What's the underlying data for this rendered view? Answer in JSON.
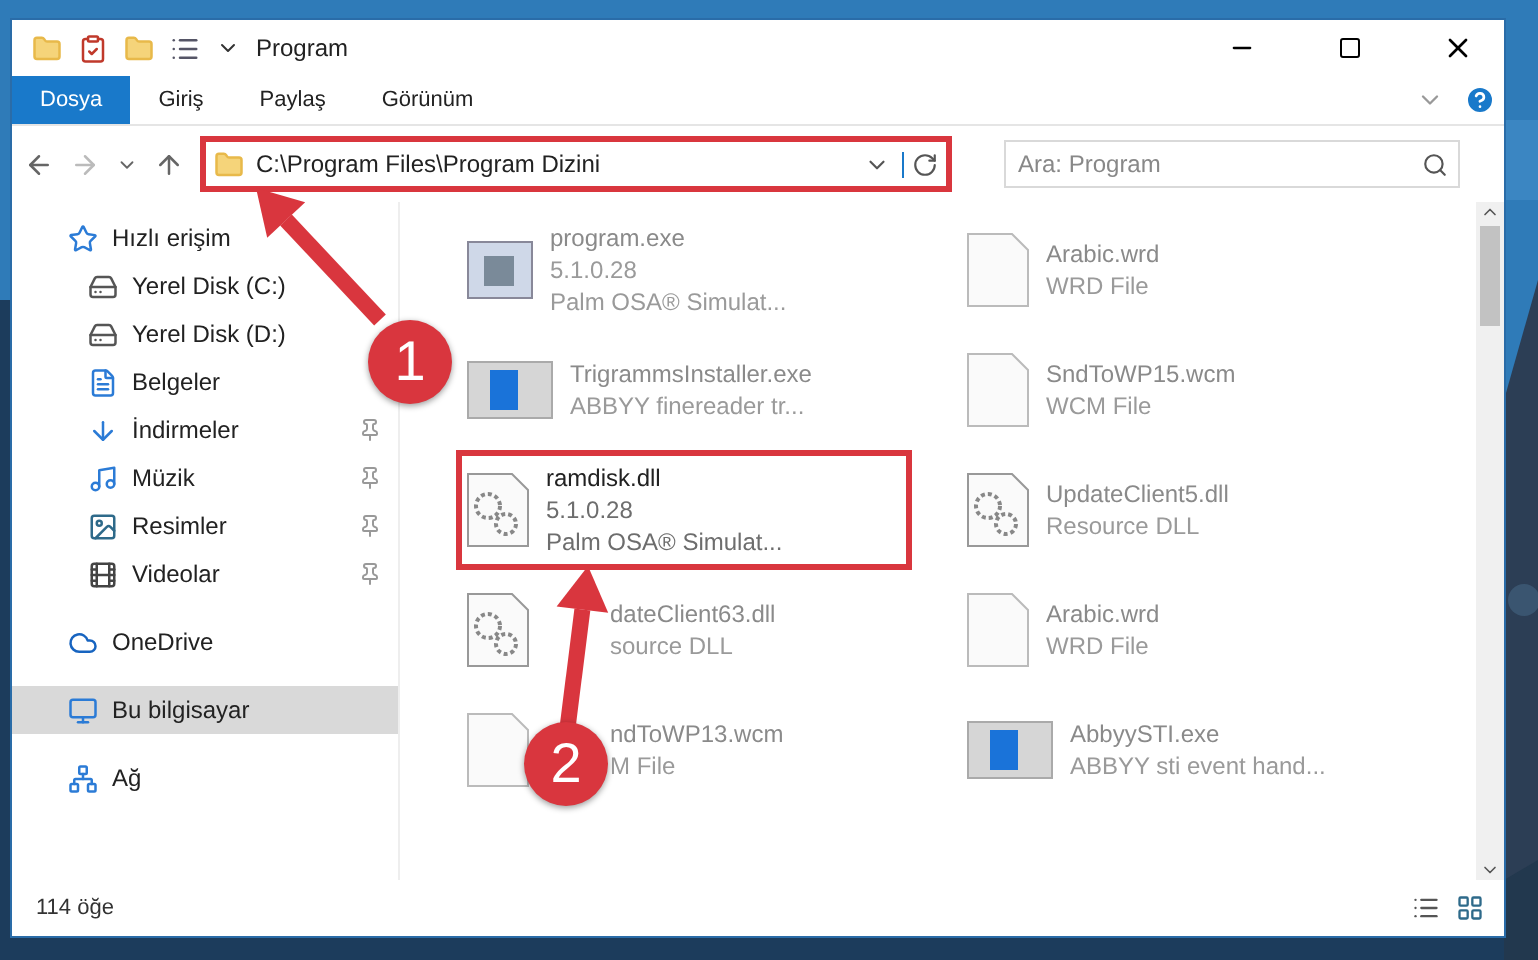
{
  "window": {
    "title": "Program"
  },
  "ribbon_tabs": [
    {
      "label": "Dosya",
      "selected": true
    },
    {
      "label": "Giriş",
      "selected": false
    },
    {
      "label": "Paylaş",
      "selected": false
    },
    {
      "label": "Görünüm",
      "selected": false
    }
  ],
  "address": {
    "path": "C:\\Program Files\\Program Dizini",
    "highlighted": true
  },
  "search": {
    "placeholder": "Ara: Program"
  },
  "sidebar": {
    "items": [
      {
        "label": "Hızlı erişim",
        "kind": "star",
        "selected": false,
        "children": [
          {
            "label": "Yerel Disk (C:)",
            "kind": "disk",
            "pinned": false
          },
          {
            "label": "Yerel Disk (D:)",
            "kind": "disk",
            "pinned": false
          },
          {
            "label": "Belgeler",
            "kind": "docs",
            "pinned": false
          },
          {
            "label": "İndirmeler",
            "kind": "download",
            "pinned": true
          },
          {
            "label": "Müzik",
            "kind": "music",
            "pinned": true
          },
          {
            "label": "Resimler",
            "kind": "pictures",
            "pinned": true
          },
          {
            "label": "Videolar",
            "kind": "video",
            "pinned": true
          }
        ]
      },
      {
        "label": "OneDrive",
        "kind": "cloud",
        "selected": false
      },
      {
        "label": "Bu bilgisayar",
        "kind": "pc",
        "selected": true
      },
      {
        "label": "Ağ",
        "kind": "network",
        "selected": false
      }
    ]
  },
  "files": [
    {
      "name": "program.exe",
      "lines": [
        "5.1.0.28",
        "Palm OSA® Simulat..."
      ],
      "kind": "exe",
      "blurred": true,
      "highlighted": false
    },
    {
      "name": "Arabic.wrd",
      "lines": [
        "WRD File"
      ],
      "kind": "blank",
      "blurred": true,
      "highlighted": false
    },
    {
      "name": "TrigrammsInstaller.exe",
      "lines": [
        "ABBYY finereader tr..."
      ],
      "kind": "installer",
      "blurred": true,
      "highlighted": false
    },
    {
      "name": "SndToWP15.wcm",
      "lines": [
        "WCM File"
      ],
      "kind": "blank",
      "blurred": true,
      "highlighted": false
    },
    {
      "name": "ramdisk.dll",
      "lines": [
        "5.1.0.28",
        "Palm OSA® Simulat..."
      ],
      "kind": "dll",
      "blurred": false,
      "highlighted": true
    },
    {
      "name": "UpdateClient5.dll",
      "lines": [
        "Resource DLL"
      ],
      "kind": "dll",
      "blurred": true,
      "highlighted": false
    },
    {
      "name": "dateClient63.dll",
      "lines": [
        "source DLL"
      ],
      "kind": "dll",
      "blurred": true,
      "highlighted": false
    },
    {
      "name": "Arabic.wrd",
      "lines": [
        "WRD File"
      ],
      "kind": "blank",
      "blurred": true,
      "highlighted": false
    },
    {
      "name": "ndToWP13.wcm",
      "lines": [
        "M File"
      ],
      "kind": "blank",
      "blurred": true,
      "highlighted": false
    },
    {
      "name": "AbbyySTI.exe",
      "lines": [
        "ABBYY sti event hand..."
      ],
      "kind": "installer",
      "blurred": true,
      "highlighted": false
    }
  ],
  "status_bar": {
    "count": "114 öğe"
  },
  "annotations": [
    {
      "number": "1"
    },
    {
      "number": "2"
    }
  ]
}
